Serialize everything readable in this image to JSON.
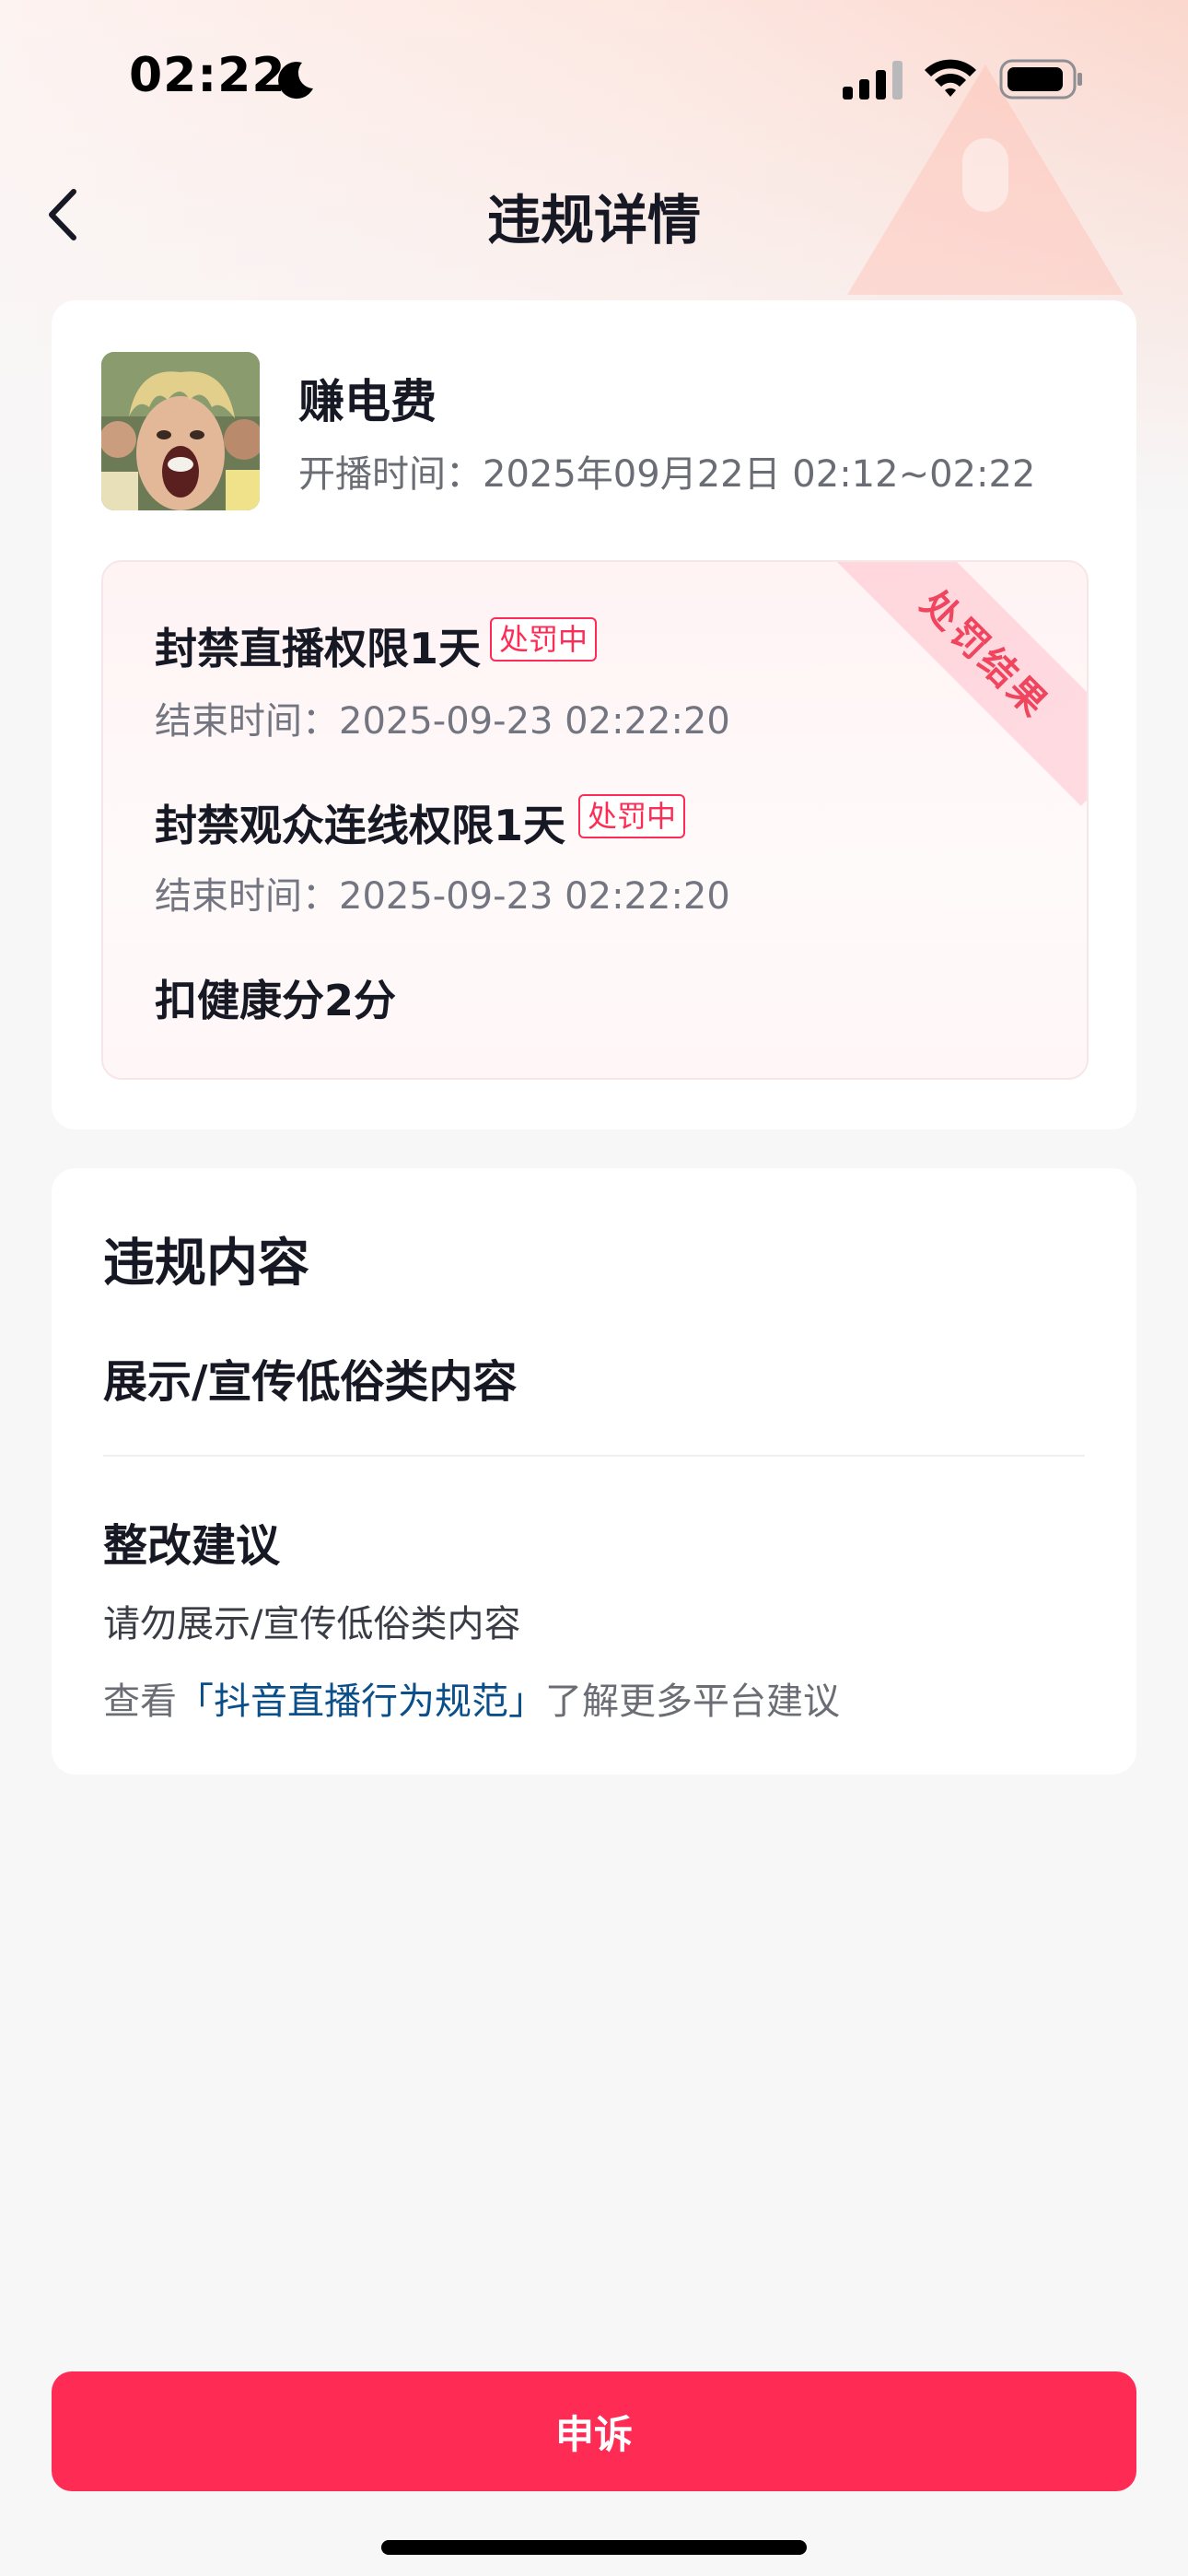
{
  "status_bar": {
    "time": "02:22"
  },
  "nav": {
    "title": "违规详情"
  },
  "stream": {
    "title": "赚电费",
    "time_label": "开播时间：",
    "time_value": "2025年09月22日 02:12~02:22"
  },
  "penalty": {
    "ribbon": "处罚结果",
    "items": [
      {
        "title": "封禁直播权限1天",
        "tag": "处罚中",
        "end_label": "结束时间：",
        "end_value": "2025-09-23 02:22:20"
      },
      {
        "title": "封禁观众连线权限1天",
        "tag": "处罚中",
        "end_label": "结束时间：",
        "end_value": "2025-09-23 02:22:20"
      },
      {
        "title": "扣健康分2分"
      }
    ]
  },
  "violation": {
    "section_title": "违规内容",
    "content": "展示/宣传低俗类内容",
    "suggestion_title": "整改建议",
    "suggestion_text": "请勿展示/宣传低俗类内容",
    "rule_prefix": "查看",
    "rule_link": "「抖音直播行为规范」",
    "rule_suffix": "了解更多平台建议"
  },
  "appeal": {
    "label": "申诉"
  },
  "colors": {
    "accent": "#fe2c55",
    "link": "#0b4f8a"
  },
  "icons": [
    "moon-icon",
    "cellular-signal-icon",
    "wifi-icon",
    "battery-icon",
    "back-chevron-icon"
  ]
}
